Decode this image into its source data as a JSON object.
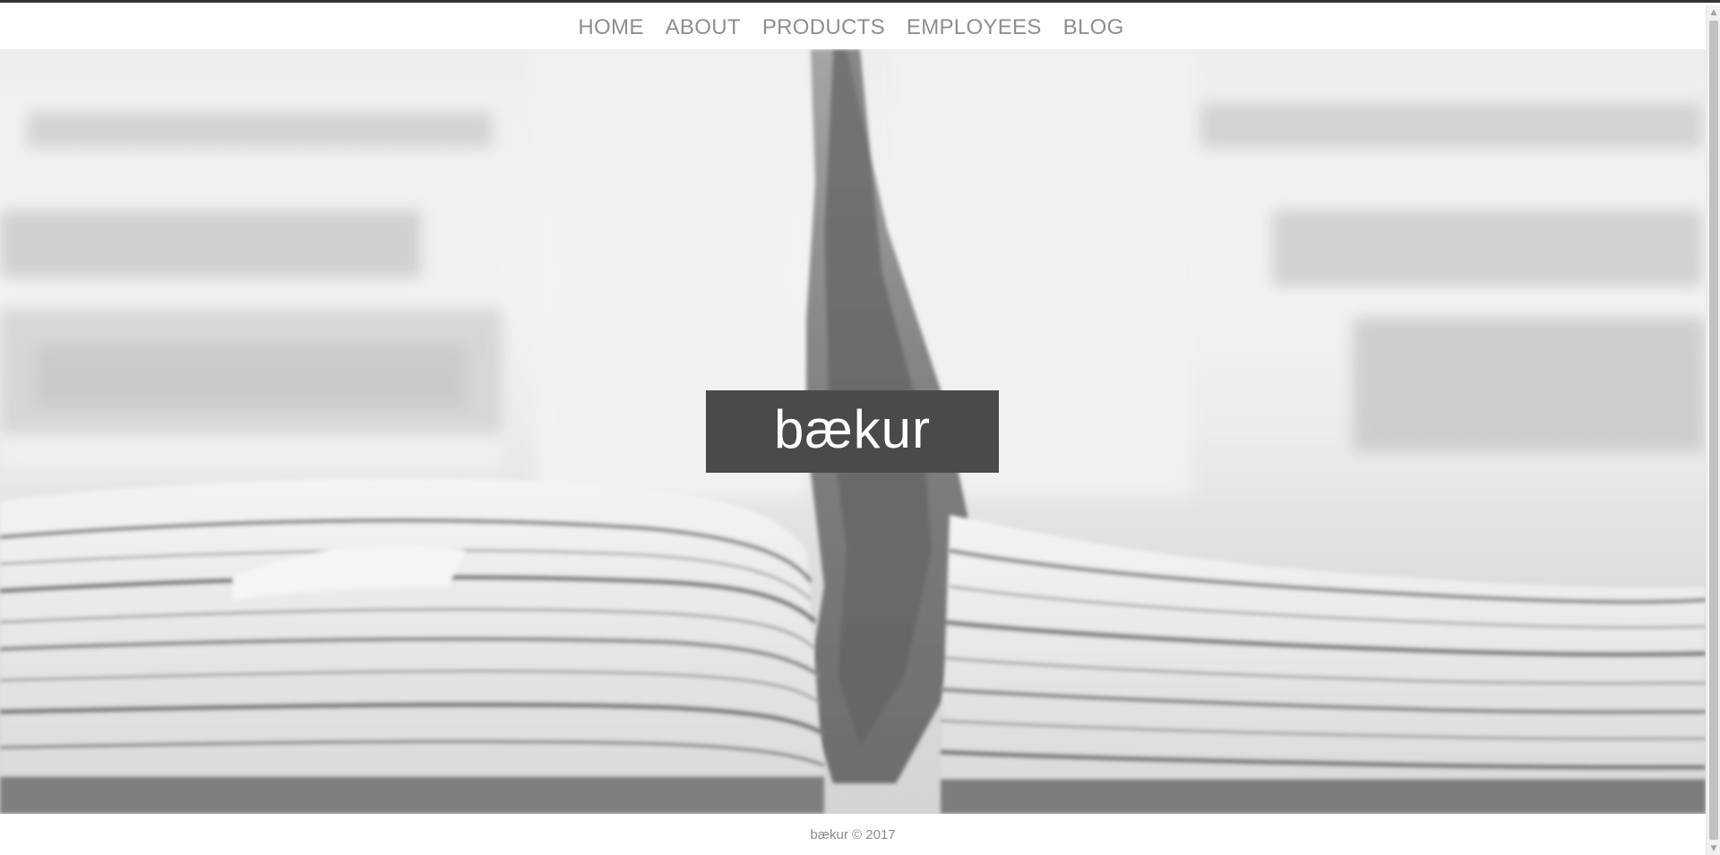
{
  "nav": {
    "items": [
      {
        "label": "HOME"
      },
      {
        "label": "ABOUT"
      },
      {
        "label": "PRODUCTS"
      },
      {
        "label": "EMPLOYEES"
      },
      {
        "label": "BLOG"
      }
    ]
  },
  "hero": {
    "brand": "bækur",
    "background_image": "stacked-newspapers-image"
  },
  "footer": {
    "text": "bækur © 2017"
  },
  "colors": {
    "nav_text": "#8e8e8e",
    "brand_box": "#4a4a4a",
    "brand_text": "#ffffff",
    "footer_text": "#8c8c8c"
  },
  "scrollbar": {
    "up_icon": "arrow-up-icon",
    "down_icon": "arrow-down-icon"
  }
}
